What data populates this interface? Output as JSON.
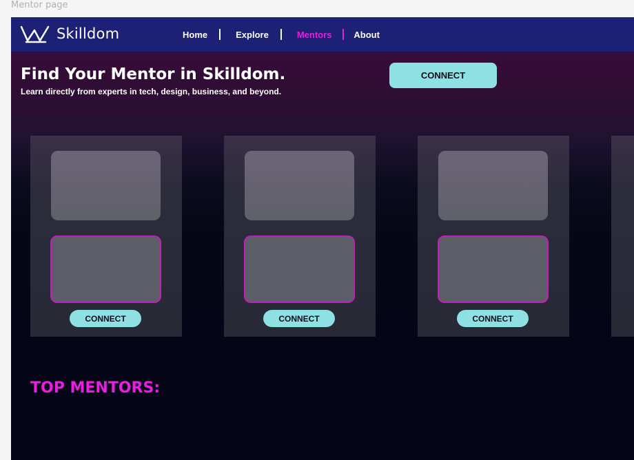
{
  "canvas": {
    "frame_label": "Mentor page"
  },
  "brand": {
    "name": "Skilldom",
    "logo_icon": "crown-icon"
  },
  "nav": {
    "items": [
      {
        "label": "Home",
        "active": false
      },
      {
        "label": "Explore",
        "active": false
      },
      {
        "label": "Mentors",
        "active": true
      },
      {
        "label": "About",
        "active": false
      }
    ]
  },
  "hero": {
    "title": "Find Your Mentor in Skilldom.",
    "subtitle": "Learn directly from experts in tech, design, business, and beyond.",
    "connect_label": "CONNECT"
  },
  "cards": [
    {
      "connect_label": "CONNECT"
    },
    {
      "connect_label": "CONNECT"
    },
    {
      "connect_label": "CONNECT"
    }
  ],
  "section": {
    "top_mentors_heading": "TOP MENTORS:"
  },
  "colors": {
    "navbar": "#1c2175",
    "accent_pink": "#e91ee0",
    "button_cyan": "#8fe0e2",
    "card_bg": "#272a36"
  }
}
